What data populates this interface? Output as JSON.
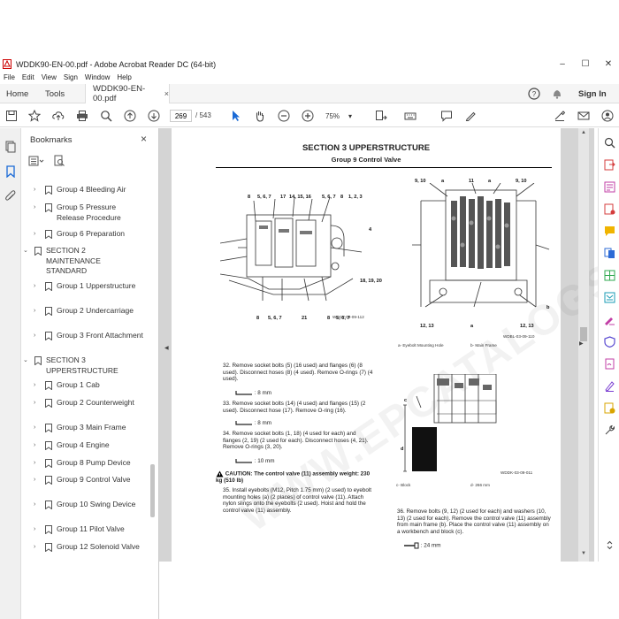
{
  "window": {
    "title": "WDDK90-EN-00.pdf - Adobe Acrobat Reader DC (64-bit)",
    "minimize": "–",
    "maximize": "☐",
    "close": "✕"
  },
  "menu": [
    "File",
    "Edit",
    "View",
    "Sign",
    "Window",
    "Help"
  ],
  "tabs": {
    "home": "Home",
    "tools": "Tools",
    "document": "WDDK90-EN-00.pdf",
    "close": "×",
    "sign_in": "Sign In"
  },
  "toolbar": {
    "page_current": "269",
    "page_total": "/ 543",
    "zoom": "75%"
  },
  "bookmarks": {
    "title": "Bookmarks",
    "items": [
      {
        "label": "Group 4 Bleeding Air",
        "twisty": "›"
      },
      {
        "label": "Group 5 Pressure Release Procedure",
        "twisty": "›"
      },
      {
        "label": "Group 6 Preparation",
        "twisty": "›"
      },
      {
        "label": "SECTION 2 MAINTENANCE STANDARD",
        "twisty": "⌄"
      },
      {
        "label": "Group 1 Upperstructure",
        "twisty": "›"
      },
      {
        "label": "Group 2 Undercarriage",
        "twisty": "›"
      },
      {
        "label": "Group 3 Front Attachment",
        "twisty": "›"
      },
      {
        "label": "SECTION 3 UPPERSTRUCTURE",
        "twisty": "⌄"
      },
      {
        "label": "Group 1 Cab",
        "twisty": "›"
      },
      {
        "label": "Group 2 Counterweight",
        "twisty": "›"
      },
      {
        "label": "Group 3 Main Frame",
        "twisty": "›"
      },
      {
        "label": "Group 4 Engine",
        "twisty": "›"
      },
      {
        "label": "Group 8 Pump Device",
        "twisty": "›"
      },
      {
        "label": "Group 9 Control Valve",
        "twisty": "›"
      },
      {
        "label": "Group 10 Swing Device",
        "twisty": "›"
      },
      {
        "label": "Group 11 Pilot Valve",
        "twisty": "›"
      },
      {
        "label": "Group 12 Solenoid Valve",
        "twisty": "›"
      }
    ]
  },
  "page": {
    "section_title": "SECTION 3 UPPERSTRUCTURE",
    "group_title": "Group 9 Control Valve",
    "watermark": "WWW.EPCATALOGS.COM",
    "fig1": {
      "labels_top": [
        "8",
        "5, 6, 7",
        "17",
        "14, 15, 16",
        "5, 6, 7",
        "8",
        "1, 2, 3"
      ],
      "labels_side": [
        "4",
        "18, 19, 20"
      ],
      "labels_bottom": [
        "8",
        "5, 6, 7",
        "21",
        "8",
        "5, 6, 7"
      ],
      "code": "WDCY-03-09-112"
    },
    "fig2": {
      "labels_top": [
        "9, 10",
        "a",
        "11",
        "a",
        "9, 10"
      ],
      "labels_bottom": [
        "12, 13",
        "a",
        "12, 13"
      ],
      "label_b": "b",
      "code": "WDBL-03-09-110",
      "legend_a": "a-   Eyebolt Mounting Hole",
      "legend_b": "b-   Main Frame"
    },
    "fig3": {
      "label_c": "c",
      "label_d": "d",
      "code": "WDDK-03-09-011",
      "legend_c": "c-   Block",
      "legend_d": "d-   266 mm"
    },
    "steps": {
      "s32": "32.  Remove socket bolts (5) (16 used) and flanges (6) (8 used). Disconnect hoses (8) (4 used). Remove O-rings (7) (4 used).",
      "t32": ": 8 mm",
      "s33": "33.  Remove socket bolts (14) (4 used) and flanges (15) (2 used). Disconnect hose (17). Remove O-ring (16).",
      "t33": ": 8 mm",
      "s34": "34.  Remove socket bolts (1, 18) (4 used for each) and flanges (2, 19) (2 used for each). Disconnect hoses (4, 21). Remove O-rings (3, 20).",
      "t34": ": 10 mm",
      "caution_label": "CAUTION:",
      "caution_text": "The control valve (11) assembly weight: 230 kg (510 lb)",
      "s35": "35.  Install eyebolts (M12, Pitch 1.75 mm) (2 used) to eyebolt mounting holes (a) (2 places) of control valve (11). Attach nylon slings onto the eyebolts (2 used). Hoist and hold the control valve (11) assembly.",
      "s36": "36.  Remove bolts (9, 12) (2 used for each) and washers (10, 13) (2 used for each). Remove the control valve (11) assembly from main frame (b). Place the control valve (11) assembly on a workbench and block (c).",
      "t36": ": 24 mm"
    }
  }
}
